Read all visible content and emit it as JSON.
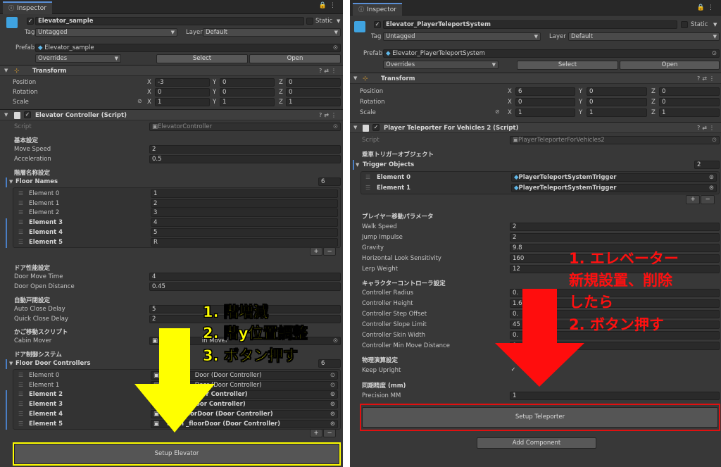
{
  "left": {
    "tab": "Inspector",
    "object_name": "Elevator_sample",
    "static_label": "Static",
    "tag_label": "Tag",
    "tag_value": "Untagged",
    "layer_label": "Layer",
    "layer_value": "Default",
    "prefab_label": "Prefab",
    "prefab_value": "Elevator_sample",
    "overrides": "Overrides",
    "select": "Select",
    "open": "Open",
    "transform": {
      "title": "Transform",
      "position_label": "Position",
      "rotation_label": "Rotation",
      "scale_label": "Scale",
      "position": [
        "-3",
        "0",
        "0"
      ],
      "rotation": [
        "0",
        "0",
        "0"
      ],
      "scale": [
        "1",
        "1",
        "1"
      ]
    },
    "script_title": "Elevator Controller (Script)",
    "script_label": "Script",
    "script_value": "ElevatorController",
    "sec_basic": "基本設定",
    "move_speed_label": "Move Speed",
    "move_speed": "2",
    "acceleration_label": "Acceleration",
    "acceleration": "0.5",
    "sec_floor_names": "階層名称設定",
    "floor_names_label": "Floor Names",
    "floor_names_count": "6",
    "floor_names": [
      {
        "label": "Element 0",
        "value": "1"
      },
      {
        "label": "Element 1",
        "value": "2"
      },
      {
        "label": "Element 2",
        "value": "3"
      },
      {
        "label": "Element 3",
        "value": "4"
      },
      {
        "label": "Element 4",
        "value": "5"
      },
      {
        "label": "Element 5",
        "value": "R"
      }
    ],
    "plus": "+",
    "minus": "−",
    "sec_door_perf": "ドア性能設定",
    "door_move_time_label": "Door Move Time",
    "door_move_time": "4",
    "door_open_distance_label": "Door Open Distance",
    "door_open_distance": "0.45",
    "sec_auto_close": "自動戸閉設定",
    "auto_close_delay_label": "Auto Close Delay",
    "auto_close_delay": "5",
    "quick_close_delay_label": "Quick Close Delay",
    "quick_close_delay": "2",
    "sec_cabin_script": "かご移動スクリプト",
    "cabin_mover_label": "Cabin Mover",
    "cabin_mover_value": "in Mover",
    "sec_door_system": "ドア制御システム",
    "floor_door_controllers_label": "Floor Door Controllers",
    "floor_door_controllers_count": "6",
    "door_controllers": [
      {
        "label": "Element 0",
        "value": "Door (Door Controller)"
      },
      {
        "label": "Element 1",
        "value": "Door (Door Controller)"
      },
      {
        "label": "Element 2",
        "value": "t Door (Door Controller)"
      },
      {
        "label": "Element 3",
        "value": "rDoor (Door Controller)"
      },
      {
        "label": "Element 4",
        "value": "udo floorDoor (Door Controller)"
      },
      {
        "label": "Element 5",
        "value": "udon _floorDoor (Door Controller)"
      }
    ],
    "setup_button": "Setup Elevator",
    "annotations": [
      "1. 階増減",
      "2. 階y位置調整",
      "3. ボタン押す"
    ],
    "colors": {
      "annotation": "#ffff00",
      "highlight": "#ffff00"
    }
  },
  "right": {
    "tab": "Inspector",
    "object_name": "Elevator_PlayerTeleportSystem",
    "static_label": "Static",
    "tag_label": "Tag",
    "tag_value": "Untagged",
    "layer_label": "Layer",
    "layer_value": "Default",
    "prefab_label": "Prefab",
    "prefab_value": "Elevator_PlayerTeleportSystem",
    "overrides": "Overrides",
    "select": "Select",
    "open": "Open",
    "transform": {
      "title": "Transform",
      "position_label": "Position",
      "rotation_label": "Rotation",
      "scale_label": "Scale",
      "position": [
        "6",
        "0",
        "0"
      ],
      "rotation": [
        "0",
        "0",
        "0"
      ],
      "scale": [
        "1",
        "1",
        "1"
      ]
    },
    "script_title": "Player Teleporter For Vehicles 2 (Script)",
    "script_label": "Script",
    "script_value": "PlayerTeleporterForVehicles2",
    "sec_trigger": "乗車トリガーオブジェクト",
    "trigger_objects_label": "Trigger Objects",
    "trigger_objects_count": "2",
    "triggers": [
      {
        "label": "Element 0",
        "value": "PlayerTeleportSystemTrigger"
      },
      {
        "label": "Element 1",
        "value": "PlayerTeleportSystemTrigger"
      }
    ],
    "plus": "+",
    "minus": "−",
    "sec_player_move": "プレイヤー移動パラメータ",
    "player_params": [
      {
        "label": "Walk Speed",
        "value": "2"
      },
      {
        "label": "Jump Impulse",
        "value": "2"
      },
      {
        "label": "Gravity",
        "value": "9.8"
      },
      {
        "label": "Horizontal Look Sensitivity",
        "value": "160"
      },
      {
        "label": "Lerp Weight",
        "value": "12"
      }
    ],
    "sec_character_controller": "キャラクターコントローラ設定",
    "controller_params": [
      {
        "label": "Controller Radius",
        "value": "0."
      },
      {
        "label": "Controller Height",
        "value": "1.6"
      },
      {
        "label": "Controller Step Offset",
        "value": "0."
      },
      {
        "label": "Controller Slope Limit",
        "value": "45"
      },
      {
        "label": "Controller Skin Width",
        "value": "0."
      },
      {
        "label": "Controller Min Move Distance",
        "value": "0"
      }
    ],
    "sec_physics": "物理演算設定",
    "keep_upright_label": "Keep Upright",
    "sec_sync": "同期精度 (mm)",
    "precision_label": "Precision MM",
    "precision_value": "1",
    "setup_button": "Setup Teleporter",
    "add_component": "Add Component",
    "annotations": [
      "1. エレベーター",
      "新規設置、削除",
      "したら",
      "2. ボタン押す"
    ],
    "colors": {
      "annotation": "#ff1010",
      "highlight": "#e01010"
    }
  }
}
